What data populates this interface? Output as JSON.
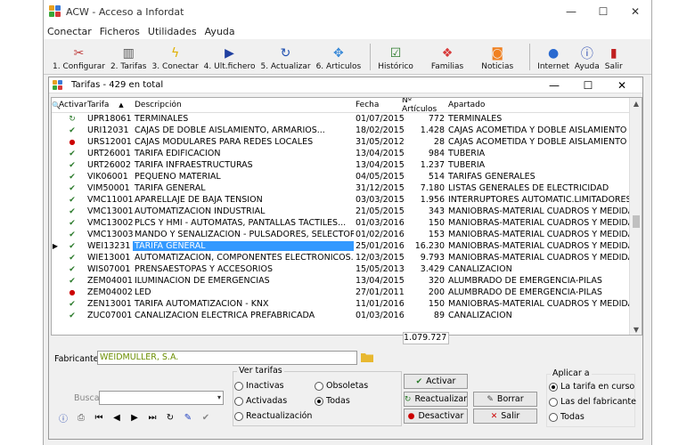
{
  "window": {
    "title": "ACW - Acceso a Infordat",
    "min": "—",
    "max": "☐",
    "close": "✕"
  },
  "menu": [
    "Conectar",
    "Ficheros",
    "Utilidades",
    "Ayuda"
  ],
  "toolbar": [
    {
      "label": "1. Configurar",
      "icon": "scissors-icon"
    },
    {
      "label": "2. Tarifas",
      "icon": "columns-icon"
    },
    {
      "label": "3. Conectar",
      "icon": "lightning-icon"
    },
    {
      "label": "4. Ult.fichero",
      "icon": "plug-icon"
    },
    {
      "label": "5. Actualizar",
      "icon": "refresh-icon"
    },
    {
      "label": "6. Articulos",
      "icon": "puzzle-icon"
    },
    {
      "label": "Histórico",
      "icon": "history-icon"
    },
    {
      "label": "Familias",
      "icon": "families-icon"
    },
    {
      "label": "Noticias",
      "icon": "rss-icon"
    },
    {
      "label": "Internet",
      "icon": "globe-icon"
    },
    {
      "label": "Ayuda",
      "icon": "info-icon"
    },
    {
      "label": "Salir",
      "icon": "exit-icon"
    }
  ],
  "inner": {
    "title": "Tarifas - 429 en total"
  },
  "columns": {
    "activar": "Activar",
    "tarifa": "Tarifa",
    "descripcion": "Descripción",
    "fecha": "Fecha",
    "articulos": "Nº Artículos",
    "apartado": "Apartado"
  },
  "rows": [
    {
      "status": "refresh",
      "tarifa": "UPR18061",
      "desc": "TERMINALES",
      "fecha": "01/07/2015",
      "art": "772",
      "apartado": "TERMINALES"
    },
    {
      "status": "check",
      "tarifa": "URI12031",
      "desc": "CAJAS DE DOBLE AISLAMIENTO, ARMARIOS...",
      "fecha": "18/02/2015",
      "art": "1.428",
      "apartado": "CAJAS ACOMETIDA Y DOBLE AISLAMIENTO"
    },
    {
      "status": "dot",
      "tarifa": "URS12001",
      "desc": "CAJAS MODULARES PARA REDES LOCALES",
      "fecha": "31/05/2012",
      "art": "28",
      "apartado": "CAJAS ACOMETIDA Y DOBLE AISLAMIENTO"
    },
    {
      "status": "check",
      "tarifa": "URT26001",
      "desc": "TARIFA EDIFICACION",
      "fecha": "13/04/2015",
      "art": "984",
      "apartado": "TUBERIA"
    },
    {
      "status": "check",
      "tarifa": "URT26002",
      "desc": "TARIFA INFRAESTRUCTURAS",
      "fecha": "13/04/2015",
      "art": "1.237",
      "apartado": "TUBERIA"
    },
    {
      "status": "check",
      "tarifa": "VIK06001",
      "desc": "PEQUEÑO MATERIAL",
      "fecha": "04/05/2015",
      "art": "514",
      "apartado": "TARIFAS GENERALES"
    },
    {
      "status": "check",
      "tarifa": "VIM50001",
      "desc": "TARIFA GENERAL",
      "fecha": "31/12/2015",
      "art": "7.180",
      "apartado": "LISTAS GENERALES DE ELECTRICIDAD"
    },
    {
      "status": "check",
      "tarifa": "VMC11001",
      "desc": "APARELLAJE DE BAJA TENSIÓN",
      "fecha": "03/03/2015",
      "art": "1.956",
      "apartado": "INTERRUPTORES AUTOMATIC.LIMITADORES"
    },
    {
      "status": "check",
      "tarifa": "VMC13001",
      "desc": "AUTOMATIZACIÓN INDUSTRIAL",
      "fecha": "21/05/2015",
      "art": "343",
      "apartado": "MANIOBRAS-MATERIAL CUADROS Y MEDIDA"
    },
    {
      "status": "check",
      "tarifa": "VMC13002",
      "desc": "PLCS Y HMI - AUTÓMATAS, PANTALLAS TÁCTILES...",
      "fecha": "01/03/2016",
      "art": "150",
      "apartado": "MANIOBRAS-MATERIAL CUADROS Y MEDIDA"
    },
    {
      "status": "check",
      "tarifa": "VMC13003",
      "desc": "MANDO Y SEÑALIZACIÓN - PULSADORES, SELECTORES",
      "fecha": "01/02/2016",
      "art": "153",
      "apartado": "MANIOBRAS-MATERIAL CUADROS Y MEDIDA"
    },
    {
      "status": "check",
      "tarifa": "WEI13231",
      "desc": "TARIFA GENERAL",
      "fecha": "25/01/2016",
      "art": "16.230",
      "apartado": "MANIOBRAS-MATERIAL CUADROS Y MEDIDA",
      "selected": true
    },
    {
      "status": "check",
      "tarifa": "WIE13001",
      "desc": "AUTOMATIZACIÓN, COMPONENTES ELECTRÓNICOS...",
      "fecha": "12/03/2015",
      "art": "9.793",
      "apartado": "MANIOBRAS-MATERIAL CUADROS Y MEDIDA"
    },
    {
      "status": "check",
      "tarifa": "WIS07001",
      "desc": "PRENSAESTOPAS Y ACCESORIOS",
      "fecha": "15/05/2013",
      "art": "3.429",
      "apartado": "CANALIZACION"
    },
    {
      "status": "check",
      "tarifa": "ZEM04001",
      "desc": "ILUMINACIÓN DE EMERGENCIAS",
      "fecha": "13/04/2015",
      "art": "320",
      "apartado": "ALUMBRADO DE EMERGENCIA-PILAS"
    },
    {
      "status": "dot",
      "tarifa": "ZEM04002",
      "desc": "LED",
      "fecha": "27/01/2011",
      "art": "200",
      "apartado": "ALUMBRADO DE EMERGENCIA-PILAS"
    },
    {
      "status": "check",
      "tarifa": "ZEN13001",
      "desc": "TARIFA AUTOMATIZACIÓN - KNX",
      "fecha": "11/01/2016",
      "art": "150",
      "apartado": "MANIOBRAS-MATERIAL CUADROS Y MEDIDA"
    },
    {
      "status": "check",
      "tarifa": "ZUC07001",
      "desc": "CANALIZACIÓN ELÉCTRICA PREFABRICADA",
      "fecha": "01/03/2016",
      "art": "89",
      "apartado": "CANALIZACION"
    }
  ],
  "total": "1.079.727",
  "fabricante": {
    "label": "Fabricante:",
    "value": "WEIDMULLER, S.A."
  },
  "buscar": {
    "label": "Buscar:"
  },
  "ver_tarifas": {
    "label": "Ver tarifas",
    "options": [
      "Inactivas",
      "Obsoletas",
      "Activadas",
      "Todas",
      "Reactualización"
    ],
    "selected": "Todas"
  },
  "buttons": {
    "activar": "Activar",
    "reactualizar": "Reactualizar",
    "borrar": "Borrar",
    "desactivar": "Desactivar",
    "salir": "Salir"
  },
  "aplicar": {
    "label": "Aplicar a",
    "options": [
      "La tarifa en curso",
      "Las del fabricante",
      "Todas"
    ],
    "selected": "La tarifa en curso"
  },
  "colors": {
    "selection": "#3399ff",
    "check": "#2a7a2a",
    "dot": "#cc0000",
    "fabricante_text": "#6b8e00"
  }
}
